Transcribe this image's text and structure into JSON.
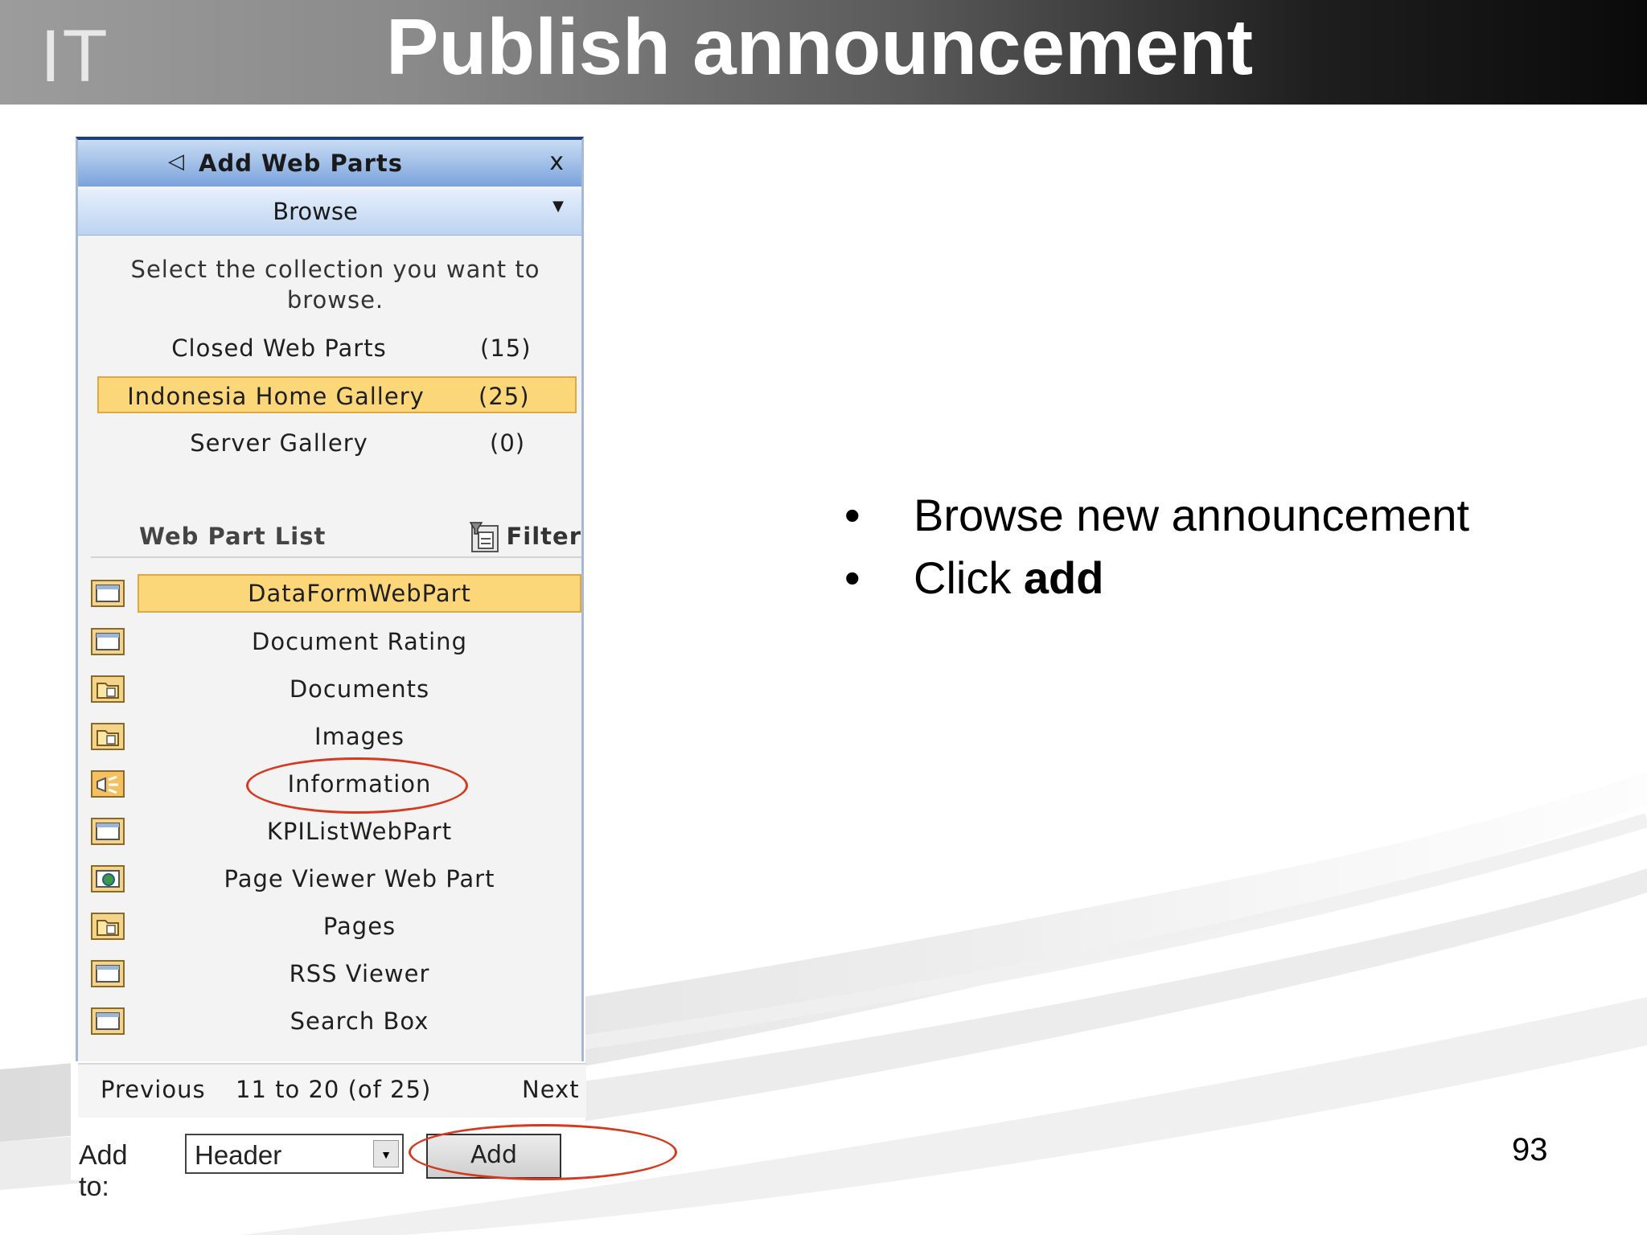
{
  "slide": {
    "logo": "IT",
    "title": "Publish announcement",
    "page_number": "93"
  },
  "panel": {
    "title": "Add Web Parts",
    "close": "x",
    "browse_label": "Browse",
    "instruction": "Select the collection you want to browse.",
    "collections": [
      {
        "name": "Closed Web Parts",
        "count": "(15)",
        "selected": false
      },
      {
        "name": "Indonesia Home Gallery",
        "count": "(25)",
        "selected": true
      },
      {
        "name": "Server Gallery",
        "count": "(0)",
        "selected": false
      }
    ],
    "list_heading": "Web Part List",
    "filter_label": "Filter",
    "web_parts": [
      {
        "label": "DataFormWebPart",
        "icon": "webpart-icon",
        "selected": true
      },
      {
        "label": "Document Rating",
        "icon": "webpart-icon",
        "selected": false
      },
      {
        "label": "Documents",
        "icon": "library-icon",
        "selected": false
      },
      {
        "label": "Images",
        "icon": "library-icon",
        "selected": false
      },
      {
        "label": "Information",
        "icon": "announcement-icon",
        "selected": false
      },
      {
        "label": "KPIListWebPart",
        "icon": "webpart-icon",
        "selected": false
      },
      {
        "label": "Page Viewer Web Part",
        "icon": "page-viewer-icon",
        "selected": false
      },
      {
        "label": "Pages",
        "icon": "library-icon",
        "selected": false
      },
      {
        "label": "RSS Viewer",
        "icon": "webpart-icon",
        "selected": false
      },
      {
        "label": "Search Box",
        "icon": "webpart-icon",
        "selected": false
      }
    ],
    "pager": {
      "previous": "Previous",
      "range": "11 to 20 (of 25)",
      "next": "Next"
    },
    "add_to_label": "Add to:",
    "add_to_value": "Header",
    "add_button": "Add"
  },
  "bullets": {
    "items": [
      {
        "text": "Browse new announcement",
        "prefix": "",
        "bold": ""
      },
      {
        "text": "",
        "prefix": "Click ",
        "bold": "add"
      }
    ],
    "bullet_char": "•"
  },
  "colors": {
    "highlight": "#fbd77a",
    "annotation_ring": "#d53a1f",
    "title_bar": "#7aa3dc"
  }
}
